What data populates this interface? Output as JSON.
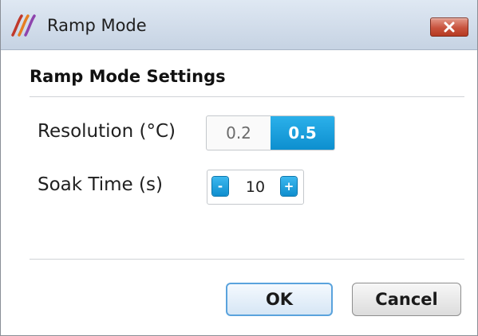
{
  "window": {
    "title": "Ramp Mode",
    "close_label": "×"
  },
  "section": {
    "title": "Ramp Mode Settings"
  },
  "resolution": {
    "label": "Resolution (°C)",
    "options": [
      "0.2",
      "0.5"
    ],
    "selected": "0.5"
  },
  "soak_time": {
    "label": "Soak Time (s)",
    "minus_label": "-",
    "plus_label": "+",
    "value": "10"
  },
  "buttons": {
    "ok": "OK",
    "cancel": "Cancel"
  },
  "colors": {
    "accent": "#1a9fdf",
    "close": "#c8533d"
  },
  "icons": {
    "app": "app-icon",
    "close": "close-icon"
  }
}
